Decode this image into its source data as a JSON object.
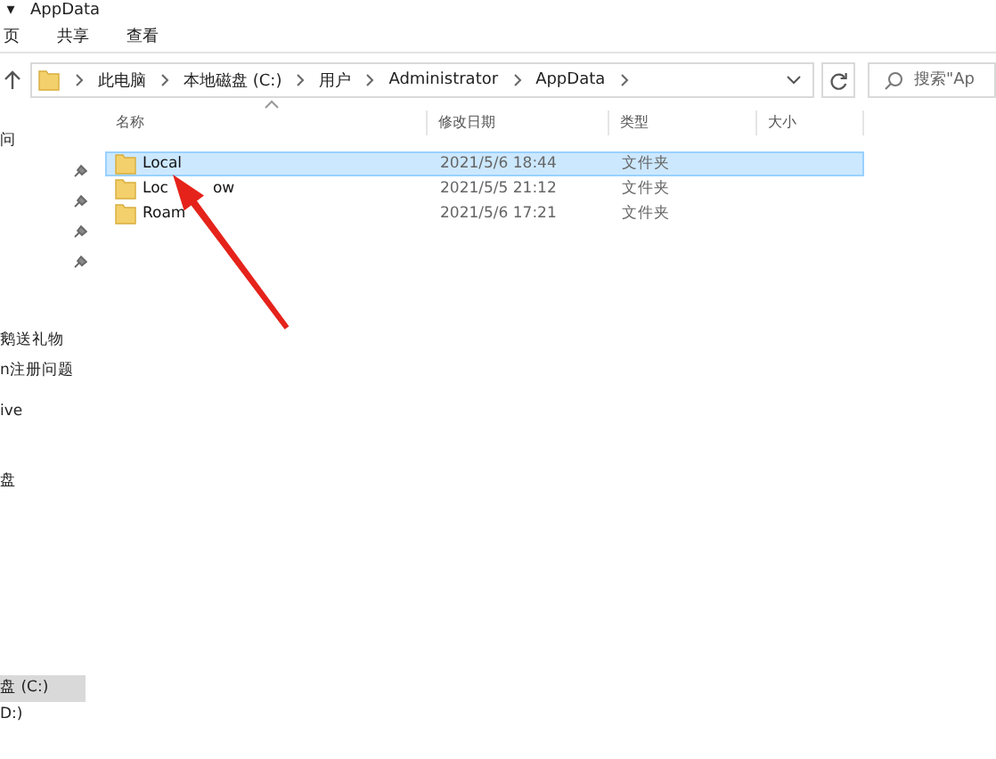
{
  "window": {
    "title": "AppData",
    "menu_glyph": "▾"
  },
  "ribbon_tabs": [
    {
      "label": "页",
      "selected": false
    },
    {
      "label": "共享",
      "selected": false
    },
    {
      "label": "查看",
      "selected": false
    }
  ],
  "address_bar": {
    "crumbs": [
      "此电脑",
      "本地磁盘 (C:)",
      "用户",
      "Administrator",
      "AppData"
    ]
  },
  "search": {
    "placeholder": "搜索\"Ap"
  },
  "sidebar": {
    "quick_access": [
      {
        "label": "问",
        "pinned": false
      },
      {
        "pinned": true
      },
      {
        "pinned": true
      },
      {
        "pinned": true
      },
      {
        "pinned": true
      }
    ],
    "links": [
      "鹅送礼物",
      "n注册问题",
      "ive",
      "盘"
    ],
    "drives": [
      {
        "label": "盘 (C:)",
        "selected": true
      },
      {
        "label": "D:)",
        "selected": false
      }
    ]
  },
  "table": {
    "columns": [
      "名称",
      "修改日期",
      "类型",
      "大小"
    ],
    "rows": [
      {
        "name": "Local",
        "modified": "2021/5/6 18:44",
        "type": "文件夹",
        "selected": true
      },
      {
        "name": "Loc",
        "name_after_arrow": "ow",
        "modified": "2021/5/5 21:12",
        "type": "文件夹",
        "selected": false
      },
      {
        "name": "Roam",
        "modified": "2021/5/6 17:21",
        "type": "文件夹",
        "selected": false
      }
    ]
  }
}
